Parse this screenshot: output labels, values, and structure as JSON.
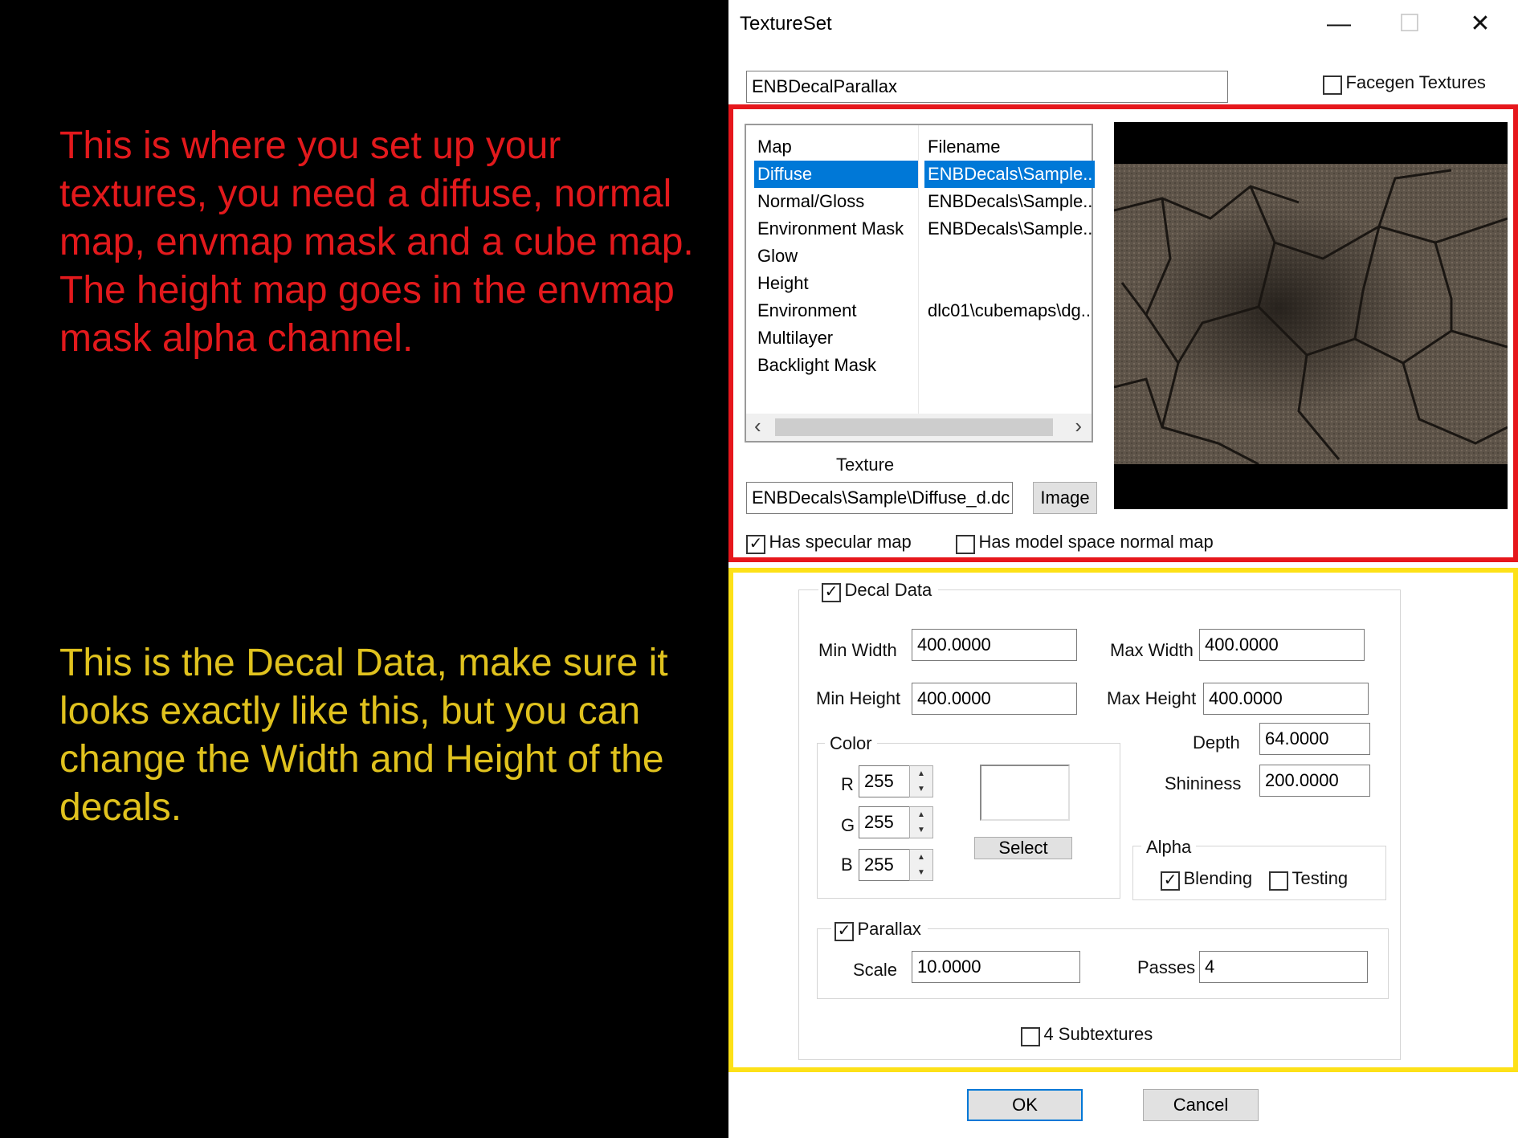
{
  "annotations": {
    "red_text": "This is where you set up your textures, you need a diffuse, normal map, envmap mask and a cube map. The height map goes in the envmap mask alpha channel.",
    "yellow_text": "This is the Decal Data, make sure it looks exactly like this, but you can change the Width and Height of the decals."
  },
  "window": {
    "title": "TextureSet",
    "minimize_glyph": "—",
    "maximize_glyph": "☐",
    "close_glyph": "✕"
  },
  "name_field": {
    "value": "ENBDecalParallax"
  },
  "facegen": {
    "label": "Facegen Textures",
    "checked": false
  },
  "maps_table": {
    "headers": [
      "Map",
      "Filename"
    ],
    "rows": [
      {
        "map": "Diffuse",
        "file": "ENBDecals\\Sample..",
        "selected": true
      },
      {
        "map": "Normal/Gloss",
        "file": "ENBDecals\\Sample.."
      },
      {
        "map": "Environment Mask",
        "file": "ENBDecals\\Sample.."
      },
      {
        "map": "Glow",
        "file": ""
      },
      {
        "map": "Height",
        "file": ""
      },
      {
        "map": "Environment",
        "file": "dlc01\\cubemaps\\dg.."
      },
      {
        "map": "Multilayer",
        "file": ""
      },
      {
        "map": "Backlight Mask",
        "file": ""
      }
    ]
  },
  "scroll": {
    "left_glyph": "‹",
    "right_glyph": "›"
  },
  "texture": {
    "label": "Texture",
    "value": "ENBDecals\\Sample\\Diffuse_d.dc",
    "button_label": "Image"
  },
  "has_specular": {
    "label": "Has specular map",
    "checked": true
  },
  "has_model_space": {
    "label": "Has model space normal map",
    "checked": false
  },
  "decal": {
    "group_label": "Decal Data",
    "checked": true,
    "min_width_label": "Min Width",
    "min_width": "400.0000",
    "max_width_label": "Max Width",
    "max_width": "400.0000",
    "min_height_label": "Min Height",
    "min_height": "400.0000",
    "max_height_label": "Max Height",
    "max_height": "400.0000",
    "depth_label": "Depth",
    "depth": "64.0000",
    "shininess_label": "Shininess",
    "shininess": "200.0000",
    "color": {
      "label": "Color",
      "r_label": "R",
      "r": "255",
      "g_label": "G",
      "g": "255",
      "b_label": "B",
      "b": "255",
      "select_label": "Select",
      "swatch": "#ffffff"
    },
    "alpha": {
      "label": "Alpha",
      "blending_label": "Blending",
      "blending": true,
      "testing_label": "Testing",
      "testing": false
    },
    "parallax": {
      "label": "Parallax",
      "checked": true,
      "scale_label": "Scale",
      "scale": "10.0000",
      "passes_label": "Passes",
      "passes": "4"
    },
    "subtextures": {
      "label": "4 Subtextures",
      "checked": false
    }
  },
  "buttons": {
    "ok": "OK",
    "cancel": "Cancel"
  },
  "spin_up": "▲",
  "spin_down": "▼",
  "check_glyph": "✓",
  "colors": {
    "annotation_red": "#e2191c",
    "annotation_yellow": "#e0c21e",
    "selection": "#0078d7"
  }
}
